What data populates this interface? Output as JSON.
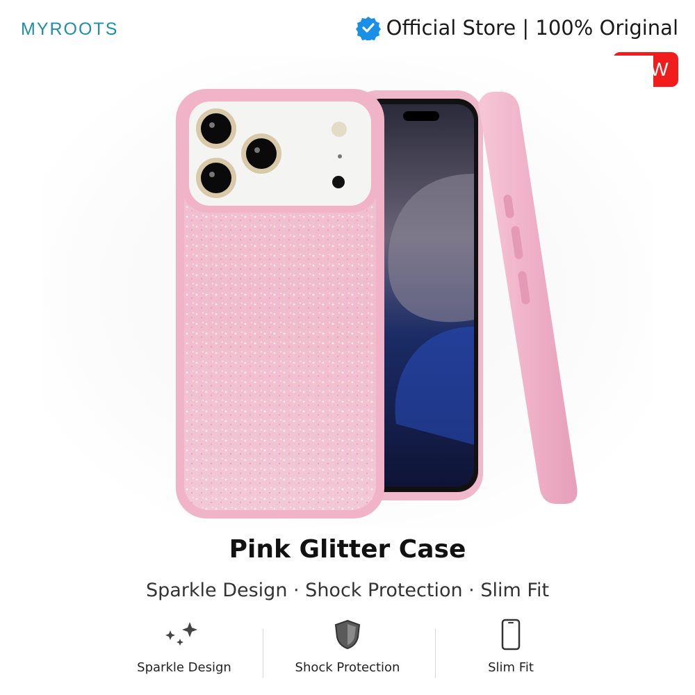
{
  "header": {
    "brand": "MYROOTS",
    "official_text": "Official Store | 100% Original",
    "new_badge": "NEW"
  },
  "product": {
    "title": "Pink Glitter Case",
    "subtitle": "Sparkle Design · Shock Protection · Slim Fit"
  },
  "features": [
    {
      "label": "Sparkle Design",
      "icon": "sparkle-icon"
    },
    {
      "label": "Shock Protection",
      "icon": "shield-icon"
    },
    {
      "label": "Slim Fit",
      "icon": "phone-outline-icon"
    }
  ],
  "colors": {
    "brand": "#1d8fa6",
    "badge": "#f11d1d",
    "verified": "#1a8fe8",
    "case_pink": "#f2b9cf"
  }
}
